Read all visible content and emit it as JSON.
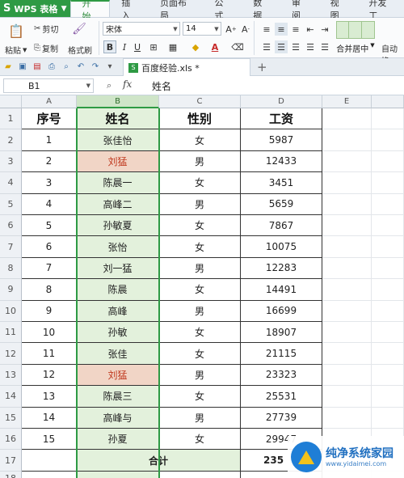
{
  "app": {
    "logo_text": "WPS 表格"
  },
  "menu_tabs": [
    "开始",
    "插入",
    "页面布局",
    "公式",
    "数据",
    "审阅",
    "视图",
    "开发工"
  ],
  "ribbon": {
    "paste": "粘贴",
    "cut": "剪切",
    "copy": "复制",
    "format_painter": "格式刷",
    "font_name": "宋体",
    "font_size": "14",
    "merge_center": "合并居中",
    "auto_wrap": "自动换"
  },
  "document": {
    "tab_title": "百度经验.xls *"
  },
  "formula_bar": {
    "cell_ref": "B1",
    "fx": "fx",
    "content": "姓名"
  },
  "sheet": {
    "columns": [
      "A",
      "B",
      "C",
      "D",
      "E"
    ],
    "row_numbers": [
      "1",
      "2",
      "3",
      "4",
      "5",
      "6",
      "7",
      "8",
      "9",
      "10",
      "11",
      "12",
      "13",
      "14",
      "15",
      "16",
      "17",
      "18"
    ],
    "headers": [
      "序号",
      "姓名",
      "性别",
      "工资"
    ],
    "rows": [
      [
        "1",
        "张佳怡",
        "女",
        "5987"
      ],
      [
        "2",
        "刘猛",
        "男",
        "12433"
      ],
      [
        "3",
        "陈晨一",
        "女",
        "3451"
      ],
      [
        "4",
        "高峰二",
        "男",
        "5659"
      ],
      [
        "5",
        "孙敏夏",
        "女",
        "7867"
      ],
      [
        "6",
        "张怡",
        "女",
        "10075"
      ],
      [
        "7",
        "刘一猛",
        "男",
        "12283"
      ],
      [
        "8",
        "陈晨",
        "女",
        "14491"
      ],
      [
        "9",
        "高峰",
        "男",
        "16699"
      ],
      [
        "10",
        "孙敏",
        "女",
        "18907"
      ],
      [
        "11",
        "张佳",
        "女",
        "21115"
      ],
      [
        "12",
        "刘猛",
        "男",
        "23323"
      ],
      [
        "13",
        "陈晨三",
        "女",
        "25531"
      ],
      [
        "14",
        "高峰与",
        "男",
        "27739"
      ],
      [
        "15",
        "孙夏",
        "女",
        "29947"
      ]
    ],
    "highlighted_rows": [
      1,
      11
    ],
    "total_label": "合计",
    "total_value": "235"
  },
  "watermark": {
    "title": "纯净系统家园",
    "url": "www.yidaimei.com"
  },
  "colors": {
    "wps_green": "#2e9a44",
    "name_col_fill": "#e3f1dc",
    "highlight_fill": "#f1d5c6",
    "highlight_text": "#c0391f"
  }
}
